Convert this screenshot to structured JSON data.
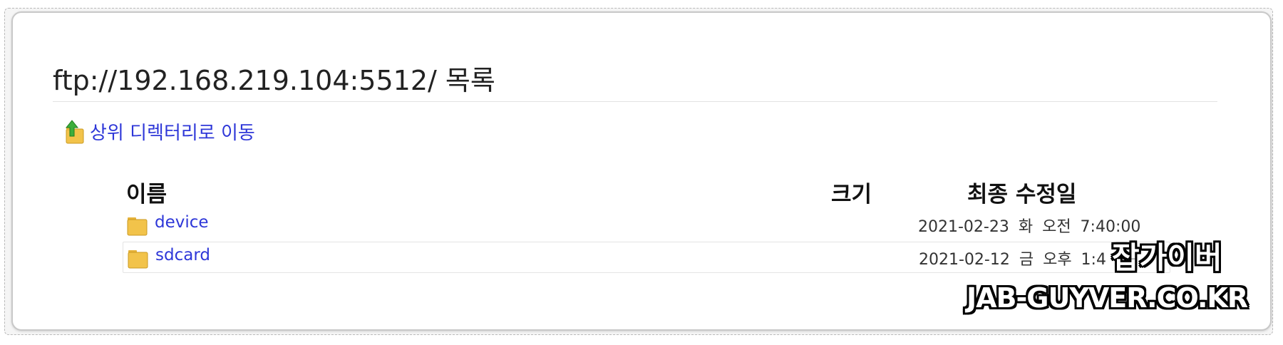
{
  "page": {
    "title": "ftp://192.168.219.104:5512/ 목록"
  },
  "up_link": {
    "label": "상위 디렉터리로 이동",
    "icon": "folder-up-arrow-icon"
  },
  "table": {
    "headers": {
      "name": "이름",
      "size": "크기",
      "modified": "최종 수정일"
    },
    "rows": [
      {
        "name": "device",
        "size": "",
        "modified": "2021-02-23 화 오전 7:40:00",
        "icon": "folder-icon"
      },
      {
        "name": "sdcard",
        "size": "",
        "modified": "2021-02-12 금 오후 1:4",
        "icon": "folder-icon"
      }
    ]
  },
  "watermark": {
    "korean": "잡가이버",
    "english": "JAB-GUYVER.CO.KR"
  },
  "colors": {
    "link": "#2e37d8",
    "folder": "#f2c34a",
    "up_arrow": "#3cae3c"
  }
}
